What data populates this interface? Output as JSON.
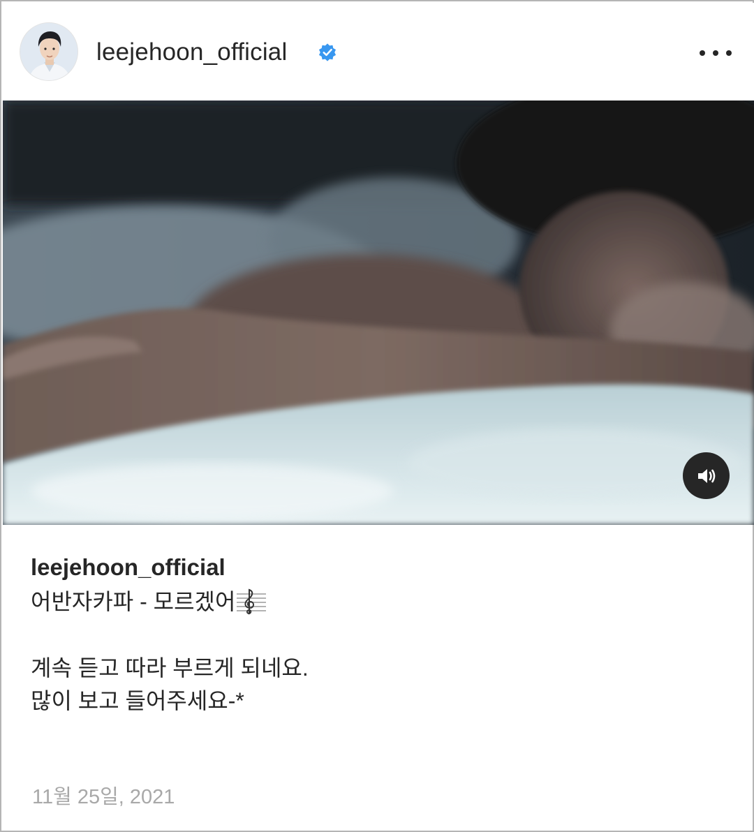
{
  "post": {
    "username": "leejehoon_official",
    "verified": true,
    "avatar": "profile-avatar",
    "more_icon": "more-options-icon",
    "media": {
      "type": "video",
      "sound_icon": "speaker-on-icon"
    },
    "caption": {
      "username": "leejehoon_official",
      "line1": "어반자카파 - 모르겠어",
      "line1_icon": "music-staff-icon",
      "line2": "계속 듣고 따라 부르게 되네요.",
      "line3": "많이 보고 들어주세요-*"
    },
    "date": "11월 25일, 2021"
  },
  "colors": {
    "verified_badge": "#3897f0",
    "text": "#262626",
    "date": "#a8a8a8",
    "border": "#b5b5b5"
  }
}
